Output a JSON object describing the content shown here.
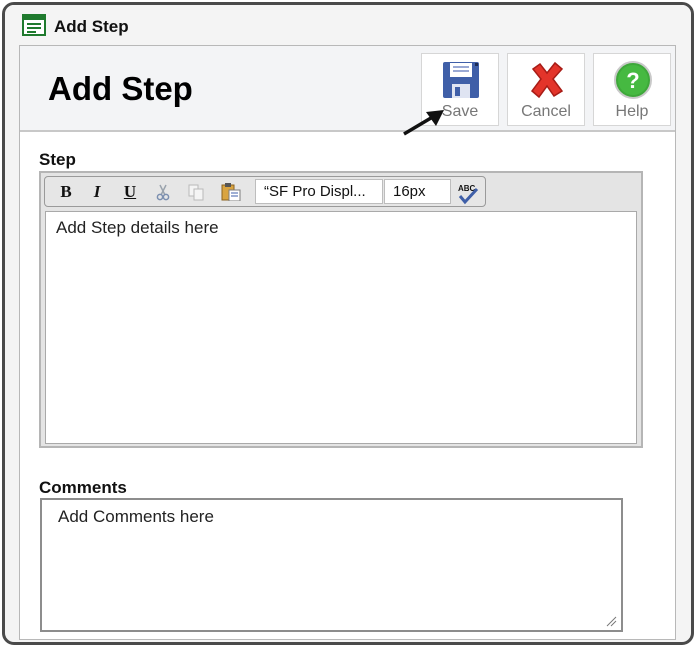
{
  "window": {
    "title": "Add Step"
  },
  "header": {
    "page_title": "Add Step"
  },
  "toolbar_buttons": {
    "save_label": "Save",
    "cancel_label": "Cancel",
    "help_label": "Help"
  },
  "step": {
    "label": "Step",
    "editor": {
      "font_value": "“SF Pro Displ...",
      "size_value": "16px",
      "tools": [
        "bold",
        "italic",
        "underline",
        "cut",
        "copy",
        "paste",
        "spellcheck"
      ],
      "bold_glyph": "B",
      "italic_glyph": "I",
      "underline_glyph": "U",
      "spellcheck_text": "ABC",
      "placeholder": "Add Step details here"
    }
  },
  "comments": {
    "label": "Comments",
    "placeholder": "Add Comments here"
  },
  "colors": {
    "save_icon": "#3f5fa8",
    "cancel_icon": "#e3342a",
    "help_icon": "#3ea83a",
    "border": "#4a4a4a"
  }
}
